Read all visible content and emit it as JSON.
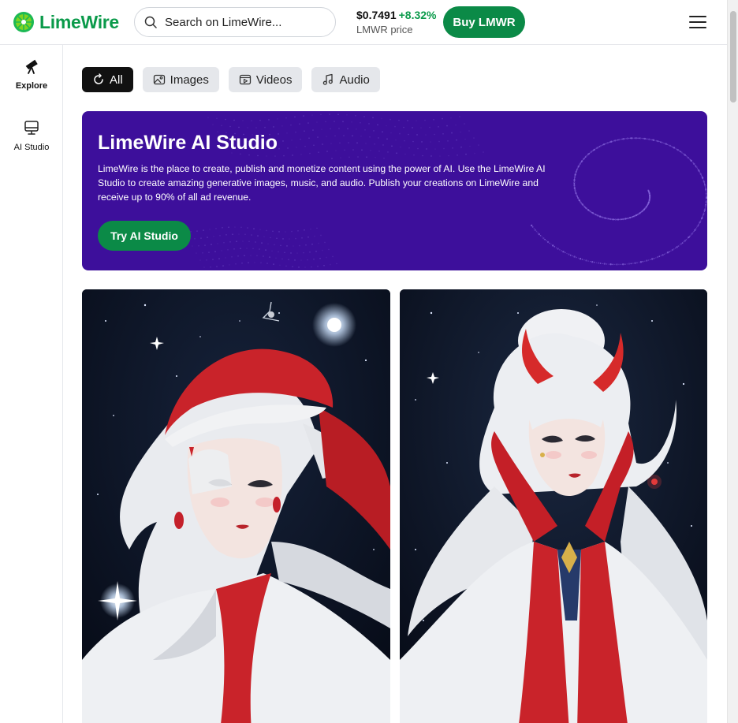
{
  "header": {
    "logo_text": "LimeWire",
    "search_placeholder": "Search on LimeWire...",
    "price": "$0.7491",
    "price_change": "+8.32%",
    "price_label": "LMWR price",
    "buy_label": "Buy LMWR",
    "menu_icon": "hamburger-menu-icon"
  },
  "sidebar": {
    "items": [
      {
        "label": "Explore",
        "icon": "telescope-icon",
        "active": true
      },
      {
        "label": "AI Studio",
        "icon": "monitor-icon",
        "active": false
      }
    ]
  },
  "tabs": [
    {
      "label": "All",
      "icon": "circle-refresh-icon",
      "active": true
    },
    {
      "label": "Images",
      "icon": "image-icon",
      "active": false
    },
    {
      "label": "Videos",
      "icon": "video-icon",
      "active": false
    },
    {
      "label": "Audio",
      "icon": "music-note-icon",
      "active": false
    }
  ],
  "banner": {
    "title": "LimeWire AI Studio",
    "description": "LimeWire is the place to create, publish and monetize content using the power of AI. Use the LimeWire AI Studio to create amazing generative images, music, and audio. Publish your creations on LimeWire and receive up to 90% of all ad revenue.",
    "button_label": "Try AI Studio"
  },
  "colors": {
    "brand_green": "#0b8a47",
    "banner_purple": "#3d0f9b",
    "price_up": "#0a9a4a"
  }
}
